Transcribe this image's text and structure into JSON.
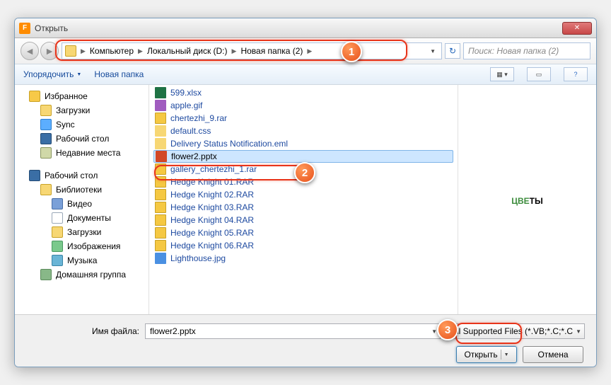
{
  "titlebar": {
    "title": "Открыть"
  },
  "breadcrumb": {
    "items": [
      "Компьютер",
      "Локальный диск (D:)",
      "Новая папка (2)"
    ]
  },
  "search": {
    "placeholder": "Поиск: Новая папка (2)"
  },
  "toolbar": {
    "organize": "Упорядочить",
    "newfolder": "Новая папка"
  },
  "sidebar": {
    "favorites": "Избранное",
    "fav_items": [
      "Загрузки",
      "Sync",
      "Рабочий стол",
      "Недавние места"
    ],
    "desktop": "Рабочий стол",
    "libraries": "Библиотеки",
    "lib_items": [
      "Видео",
      "Документы",
      "Загрузки",
      "Изображения",
      "Музыка"
    ],
    "homegroup": "Домашняя группа"
  },
  "files": [
    {
      "name": "599.xlsx",
      "ic": "fic-xls"
    },
    {
      "name": "apple.gif",
      "ic": "fic-gif"
    },
    {
      "name": "chertezhi_9.rar",
      "ic": "fic-rar"
    },
    {
      "name": "default.css",
      "ic": "fic-css"
    },
    {
      "name": "Delivery Status Notification.eml",
      "ic": "fic-eml"
    },
    {
      "name": "flower2.pptx",
      "ic": "fic-pptx",
      "selected": true
    },
    {
      "name": "gallery_chertezhi_1.rar",
      "ic": "fic-rar"
    },
    {
      "name": "Hedge Knight 01.RAR",
      "ic": "fic-rar"
    },
    {
      "name": "Hedge Knight 02.RAR",
      "ic": "fic-rar"
    },
    {
      "name": "Hedge Knight 03.RAR",
      "ic": "fic-rar"
    },
    {
      "name": "Hedge Knight 04.RAR",
      "ic": "fic-rar"
    },
    {
      "name": "Hedge Knight 05.RAR",
      "ic": "fic-rar"
    },
    {
      "name": "Hedge Knight 06.RAR",
      "ic": "fic-rar"
    },
    {
      "name": "Lighthouse.jpg",
      "ic": "fic-jpg"
    }
  ],
  "preview": {
    "text1": "ЦВЕ",
    "text2": "ТЫ"
  },
  "bottom": {
    "filename_label": "Имя файла:",
    "filename_value": "flower2.pptx",
    "filetype": "All Supported Files (*.VB;*.C;*.C",
    "open": "Открыть",
    "cancel": "Отмена"
  },
  "callouts": {
    "c1": "1",
    "c2": "2",
    "c3": "3"
  }
}
